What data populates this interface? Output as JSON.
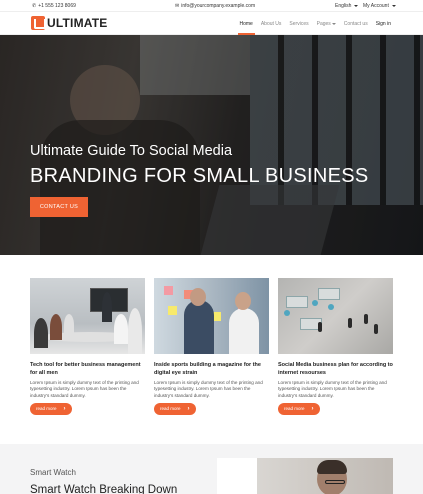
{
  "topbar": {
    "phone": "+1 555 123 8069",
    "email": "info@yourcompany.example.com",
    "language": "English",
    "account": "My Account",
    "phone_icon": "phone-icon",
    "email_icon": "envelope-icon"
  },
  "nav": {
    "brand": "ULTIMATE",
    "items": [
      {
        "label": "Home",
        "active": true
      },
      {
        "label": "About Us"
      },
      {
        "label": "Services"
      },
      {
        "label": "Pages"
      },
      {
        "label": "Contact us"
      },
      {
        "label": "Sign in"
      }
    ]
  },
  "hero": {
    "title_line1": "Ultimate Guide To Social Media",
    "title_line2": "BRANDING FOR SMALL BUSINESS",
    "cta": "CONTACT US"
  },
  "cards": [
    {
      "title": "Tech tool for better business management for all men",
      "desc": "Lorem Ipsum is simply dummy text of the printing and typesetting industry. Lorem Ipsum has been the industry's standard dummy.",
      "button": "read more"
    },
    {
      "title": "Inside sports building a magazine for the digital eye strain",
      "desc": "Lorem Ipsum is simply dummy text of the printing and typesetting industry. Lorem Ipsum has been the industry's standard dummy.",
      "button": "read more"
    },
    {
      "title": "Social Media business plan for according to internet resourses",
      "desc": "Lorem Ipsum is simply dummy text of the printing and typesetting industry. Lorem Ipsum has been the industry's standard dummy.",
      "button": "read more"
    }
  ],
  "feature": {
    "label": "Smart Watch",
    "heading": "Smart Watch Breaking Down"
  },
  "colors": {
    "accent": "#ef6333"
  }
}
